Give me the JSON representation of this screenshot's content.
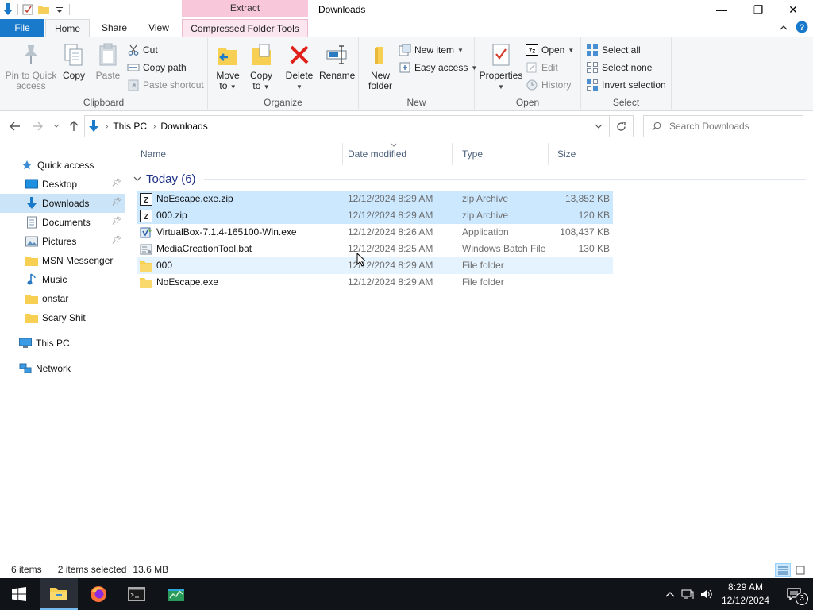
{
  "window": {
    "title": "Downloads",
    "context_header": "Extract",
    "minimize": "—",
    "maximize": "❐",
    "close": "✕"
  },
  "tabs": {
    "file": "File",
    "home": "Home",
    "share": "Share",
    "view": "View",
    "context": "Compressed Folder Tools"
  },
  "ribbon": {
    "clipboard": {
      "label": "Clipboard",
      "pin": "Pin to Quick access",
      "pin_l1": "Pin to Quick",
      "pin_l2": "access",
      "copy": "Copy",
      "paste": "Paste",
      "cut": "Cut",
      "copy_path": "Copy path",
      "paste_shortcut": "Paste shortcut"
    },
    "organize": {
      "label": "Organize",
      "move_l1": "Move",
      "move_l2": "to",
      "copy_l1": "Copy",
      "copy_l2": "to",
      "delete": "Delete",
      "rename": "Rename"
    },
    "new": {
      "label": "New",
      "folder_l1": "New",
      "folder_l2": "folder",
      "new_item": "New item",
      "easy_access": "Easy access"
    },
    "open": {
      "label": "Open",
      "properties": "Properties",
      "open": "Open",
      "edit": "Edit",
      "history": "History"
    },
    "select": {
      "label": "Select",
      "select_all": "Select all",
      "select_none": "Select none",
      "invert": "Invert selection"
    }
  },
  "address": {
    "this_pc": "This PC",
    "downloads": "Downloads",
    "search_placeholder": "Search Downloads"
  },
  "nav": {
    "quick_access": "Quick access",
    "items": [
      {
        "label": "Desktop",
        "icon": "desktop-icon",
        "pinned": true
      },
      {
        "label": "Downloads",
        "icon": "downloads-icon",
        "pinned": true,
        "selected": true
      },
      {
        "label": "Documents",
        "icon": "documents-icon",
        "pinned": true
      },
      {
        "label": "Pictures",
        "icon": "pictures-icon",
        "pinned": true
      },
      {
        "label": "MSN Messenger",
        "icon": "folder-icon"
      },
      {
        "label": "Music",
        "icon": "music-icon"
      },
      {
        "label": "onstar",
        "icon": "folder-icon"
      },
      {
        "label": "Scary Shit",
        "icon": "folder-icon"
      }
    ],
    "this_pc": "This PC",
    "network": "Network"
  },
  "columns": {
    "name": "Name",
    "date": "Date modified",
    "type": "Type",
    "size": "Size"
  },
  "group": {
    "label": "Today (6)"
  },
  "files": [
    {
      "name": "NoEscape.exe.zip",
      "date": "12/12/2024 8:29 AM",
      "type": "zip Archive",
      "size": "13,852 KB",
      "icon": "zip-icon",
      "state": "selected"
    },
    {
      "name": "000.zip",
      "date": "12/12/2024 8:29 AM",
      "type": "zip Archive",
      "size": "120 KB",
      "icon": "zip-icon",
      "state": "selected"
    },
    {
      "name": "VirtualBox-7.1.4-165100-Win.exe",
      "date": "12/12/2024 8:26 AM",
      "type": "Application",
      "size": "108,437 KB",
      "icon": "installer-icon",
      "state": ""
    },
    {
      "name": "MediaCreationTool.bat",
      "date": "12/12/2024 8:25 AM",
      "type": "Windows Batch File",
      "size": "130 KB",
      "icon": "batch-icon",
      "state": ""
    },
    {
      "name": "000",
      "date": "12/12/2024 8:29 AM",
      "type": "File folder",
      "size": "",
      "icon": "folder-icon",
      "state": "hover"
    },
    {
      "name": "NoEscape.exe",
      "date": "12/12/2024 8:29 AM",
      "type": "File folder",
      "size": "",
      "icon": "folder-icon",
      "state": ""
    }
  ],
  "status": {
    "count": "6 items",
    "selection": "2 items selected",
    "sel_size": "13.6 MB"
  },
  "taskbar": {
    "time": "8:29 AM",
    "date": "12/12/2024",
    "notifications": "3"
  },
  "colors": {
    "accent": "#1979ca",
    "selected_row": "#cce8ff",
    "nav_selected": "#cce4f7",
    "context_tab": "#f8c8da",
    "taskbar": "#101318"
  }
}
